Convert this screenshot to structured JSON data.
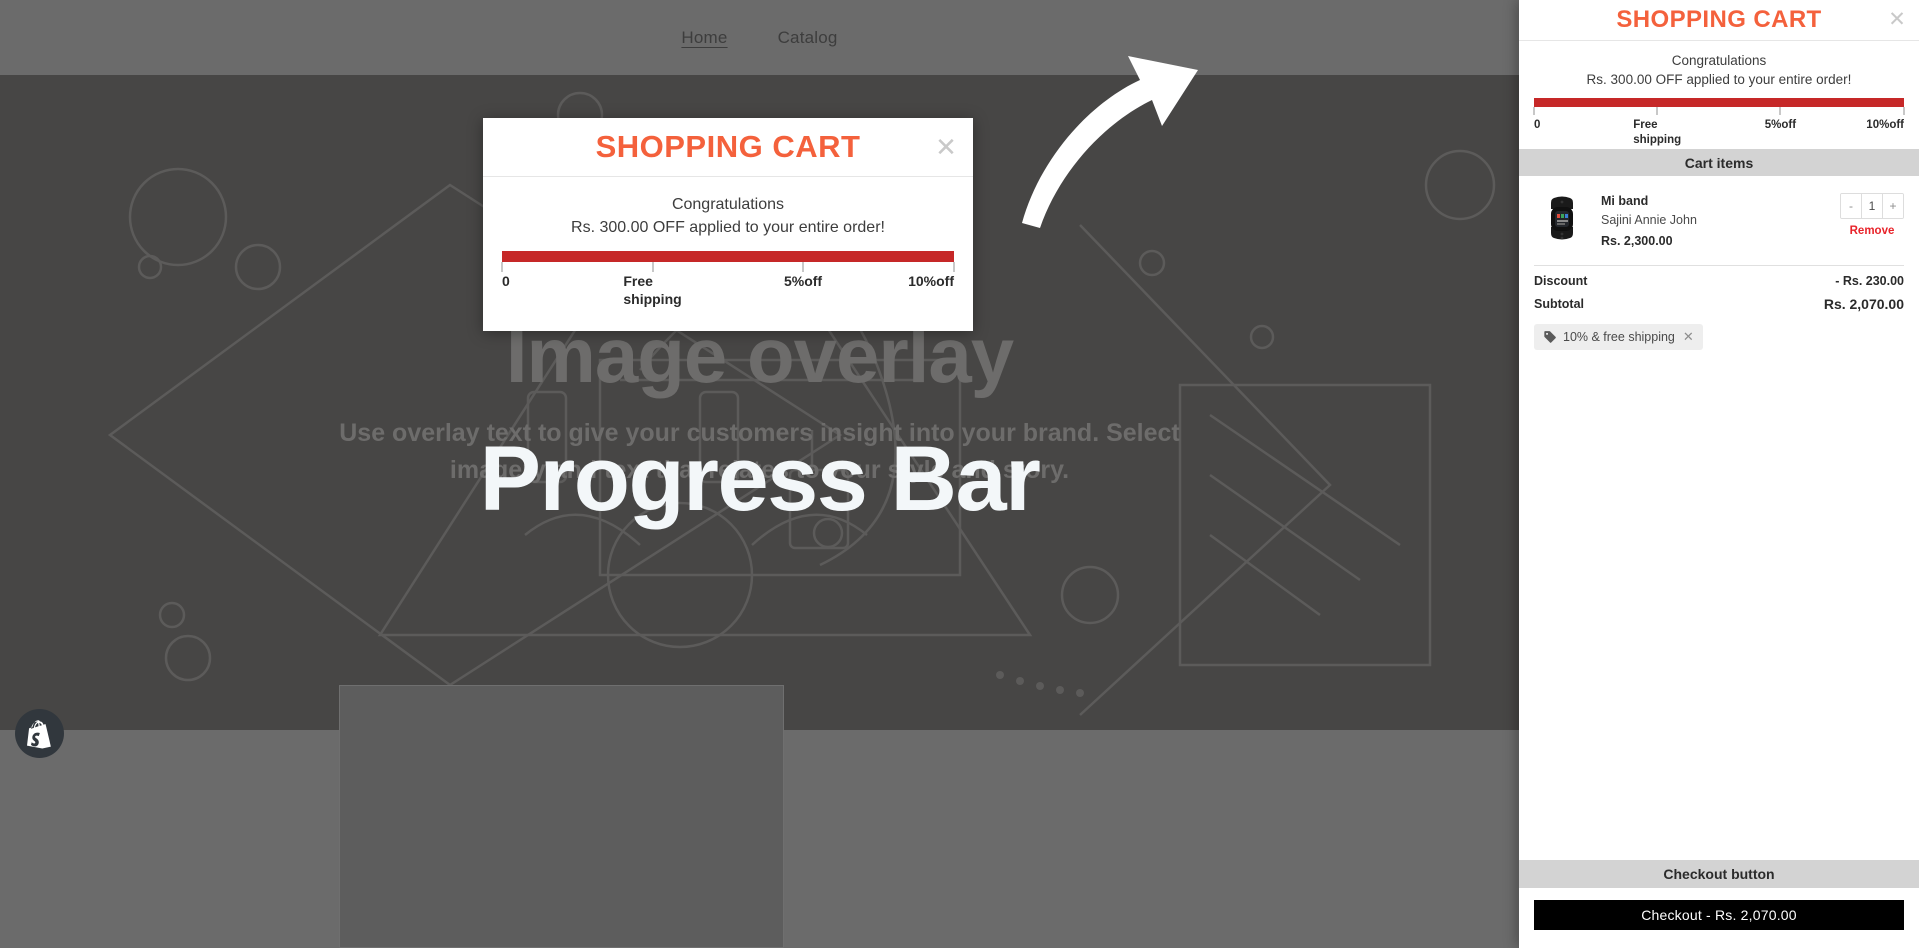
{
  "nav": {
    "items": [
      {
        "label": "Home",
        "active": true
      },
      {
        "label": "Catalog",
        "active": false
      }
    ]
  },
  "hero": {
    "title": "Image overlay",
    "subtitle": "Use overlay text to give your customers insight into your brand. Select imagery and text that relates to your style and story.",
    "annotation_label": "Progress Bar",
    "arrow_icon": "curved-arrow-up-right-icon",
    "background_art": "handbag-line-art-illustration"
  },
  "shopify_badge": {
    "icon": "shopify-bag-icon"
  },
  "modal": {
    "title": "SHOPPING CART",
    "close_icon": "close-icon",
    "congrats_line1": "Congratulations",
    "congrats_line2": "Rs. 300.00 OFF applied to your entire order!",
    "progress": {
      "fill_percent": 100,
      "fill_color": "#c62828",
      "ticks": [
        0,
        33.3,
        66.6,
        100
      ],
      "labels": [
        "0",
        "Free\nshipping",
        "5%off",
        "10%off"
      ]
    }
  },
  "drawer": {
    "title": "SHOPPING CART",
    "close_icon": "close-icon",
    "congrats_line1": "Congratulations",
    "congrats_line2": "Rs. 300.00 OFF applied to your entire order!",
    "progress": {
      "fill_percent": 100,
      "fill_color": "#c62828",
      "ticks": [
        0,
        33.3,
        66.6,
        100
      ],
      "labels": [
        "0",
        "Free\nshipping",
        "5%off",
        "10%off"
      ]
    },
    "cart_items_header": "Cart items",
    "items": [
      {
        "thumb_icon": "fitness-band-product-image",
        "title": "Mi band",
        "vendor": "Sajini Annie John",
        "price": "Rs. 2,300.00",
        "decrement_label": "-",
        "quantity": "1",
        "increment_label": "+",
        "remove_label": "Remove"
      }
    ],
    "discount_label": "Discount",
    "discount_value": "- Rs. 230.00",
    "subtotal_label": "Subtotal",
    "subtotal_value": "Rs. 2,070.00",
    "promo_tag": {
      "icon": "price-tag-icon",
      "label": "10% & free shipping",
      "remove_icon": "close-icon"
    },
    "checkout_header": "Checkout button",
    "checkout_button_label": "Checkout - Rs. 2,070.00"
  },
  "colors": {
    "accent_orange": "#f4613c",
    "progress_red": "#c62828",
    "band_gray": "#d3d3d3",
    "remove_red": "#e8232a",
    "checkout_bg": "#000000"
  }
}
